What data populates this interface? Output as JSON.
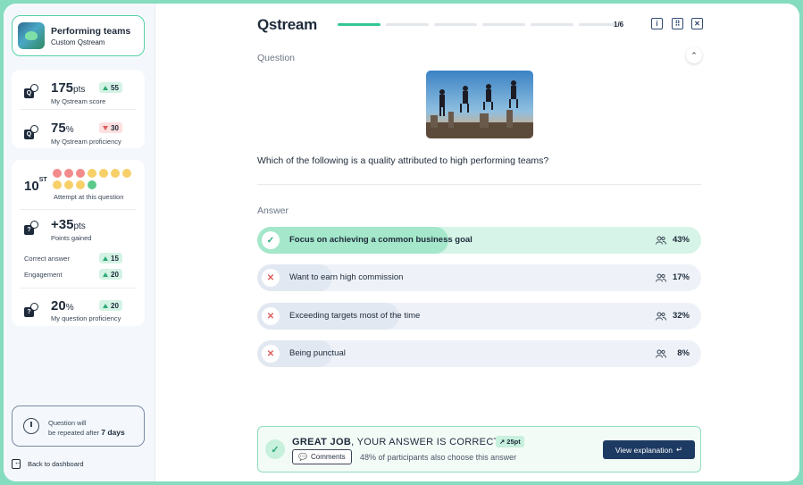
{
  "team": {
    "title": "Performing teams",
    "subtitle": "Custom Qstream"
  },
  "stats": {
    "score": {
      "value": "175",
      "unit": "pts",
      "label": "My Qstream score",
      "badge": "55",
      "badge_dir": "up"
    },
    "proficiency": {
      "value": "75",
      "unit": "%",
      "label": "My Qstream proficiency",
      "badge": "30",
      "badge_dir": "down"
    },
    "attempt": {
      "rank": "10",
      "rank_suffix": "ST",
      "label": "Attempt at this question",
      "dots": [
        "#f28b8b",
        "#f28b8b",
        "#f28b8b",
        "#f7d06a",
        "#f7d06a",
        "#f7d06a",
        "#f7d06a",
        "#f7d06a",
        "#f7d06a",
        "#f7d06a",
        "#5cc98a"
      ]
    },
    "points_gained": {
      "value": "+35",
      "unit": "pts",
      "label": "Points gained"
    },
    "correct_answer": {
      "label": "Correct answer",
      "badge": "15"
    },
    "engagement": {
      "label": "Engagement",
      "badge": "20"
    },
    "question_proficiency": {
      "value": "20",
      "unit": "%",
      "label": "My question proficiency",
      "badge": "20"
    }
  },
  "repeat": {
    "line1": "Question will",
    "line2": "be repeated after",
    "days": "7 days"
  },
  "back": {
    "label": "Back to dashboard"
  },
  "header": {
    "logo": "Qstream",
    "progress_total": 6,
    "progress_current": 1,
    "progress_text": "1/6",
    "icons": [
      "info-icon",
      "keyboard-icon",
      "close-icon"
    ]
  },
  "question": {
    "section_label": "Question",
    "text": "Which of the following is a quality attributed to high performing teams?"
  },
  "answers": {
    "section_label": "Answer",
    "items": [
      {
        "text": "Focus on achieving a common business goal",
        "pct": "43%",
        "pct_value": 0.43,
        "status": "correct"
      },
      {
        "text": "Want to earn high commission",
        "pct": "17%",
        "pct_value": 0.17,
        "status": "wrong"
      },
      {
        "text": "Exceeding targets most of the time",
        "pct": "32%",
        "pct_value": 0.32,
        "status": "wrong"
      },
      {
        "text": "Being punctual",
        "pct": "8%",
        "pct_value": 0.08,
        "status": "wrong"
      }
    ]
  },
  "result": {
    "title_bold": "GREAT JOB",
    "title_rest": ", YOUR ANSWER IS CORRECT",
    "points": "25pt",
    "comments_label": "Comments",
    "subtext": "48% of participants also choose this answer",
    "explain_label": "View explanation"
  },
  "colors": {
    "accent": "#34c594",
    "navy": "#1d3a63",
    "frame": "#86dcbe"
  }
}
